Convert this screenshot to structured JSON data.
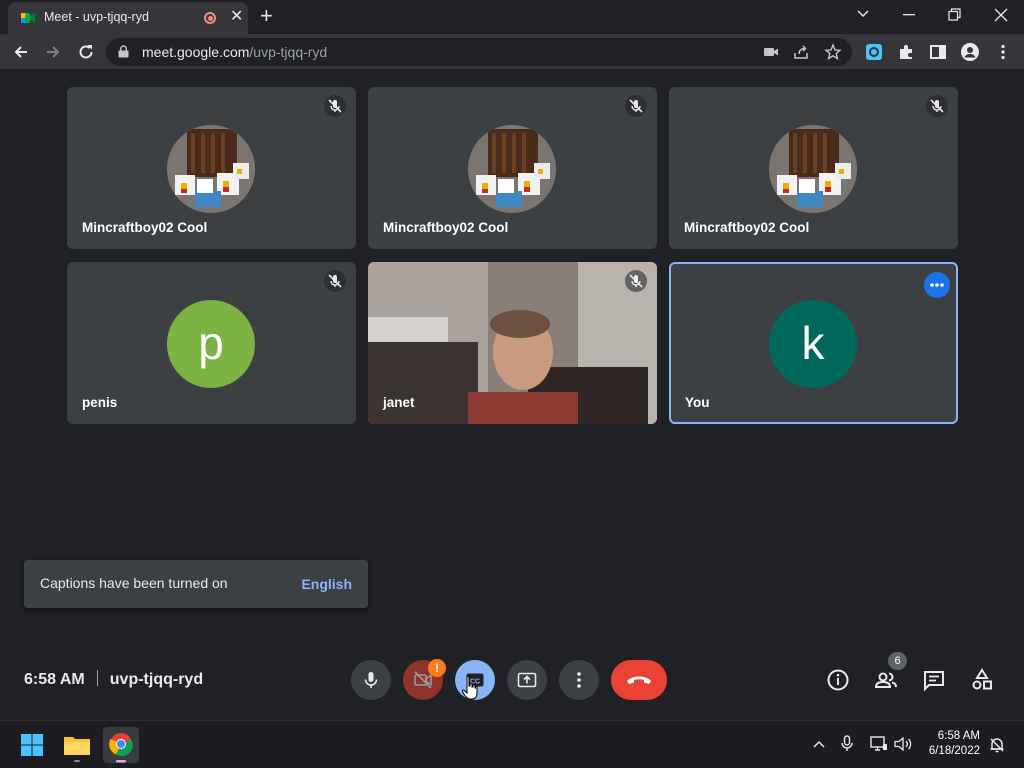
{
  "browser": {
    "tab_title": "Meet - uvp-tjqq-ryd",
    "tab_close": "✕",
    "new_tab": "+",
    "url_host": "meet.google.com",
    "url_path": "/uvp-tjqq-ryd",
    "window_controls": [
      "chevron-down",
      "minimize",
      "restore",
      "close"
    ]
  },
  "tiles": [
    {
      "name": "Mincraftboy02 Cool",
      "avatar": "minecraft-chickens-image",
      "muted": true
    },
    {
      "name": "Mincraftboy02 Cool",
      "avatar": "minecraft-chickens-image",
      "muted": true
    },
    {
      "name": "Mincraftboy02 Cool",
      "avatar": "minecraft-chickens-image",
      "muted": true
    },
    {
      "name": "penis",
      "letter": "p",
      "avatar_color": "#7cb342",
      "muted": true
    },
    {
      "name": "janet",
      "avatar": "live-camera-video",
      "muted": true
    },
    {
      "name": "You",
      "letter": "k",
      "avatar_color": "#00695c",
      "muted": false,
      "selected": true
    }
  ],
  "toast": {
    "message": "Captions have been turned on",
    "action": "English"
  },
  "meeting": {
    "time": "6:58 AM",
    "code": "uvp-tjqq-ryd",
    "camera_alert": "!",
    "people_count": "6"
  },
  "controls": [
    "microphone",
    "camera-off",
    "captions",
    "present-screen",
    "more-options",
    "leave-call"
  ],
  "side_controls": [
    "meeting-details",
    "people",
    "chat",
    "activities"
  ],
  "taskbar": {
    "apps": [
      "start",
      "file-explorer",
      "chrome"
    ],
    "clock_time": "6:58 AM",
    "clock_date": "6/18/2022"
  },
  "colors": {
    "meet_bg": "#202124",
    "tile_bg": "#3c4043",
    "accent_blue": "#8ab4f8",
    "end_call_red": "#ea4335",
    "alert_orange": "#fa7b17"
  }
}
